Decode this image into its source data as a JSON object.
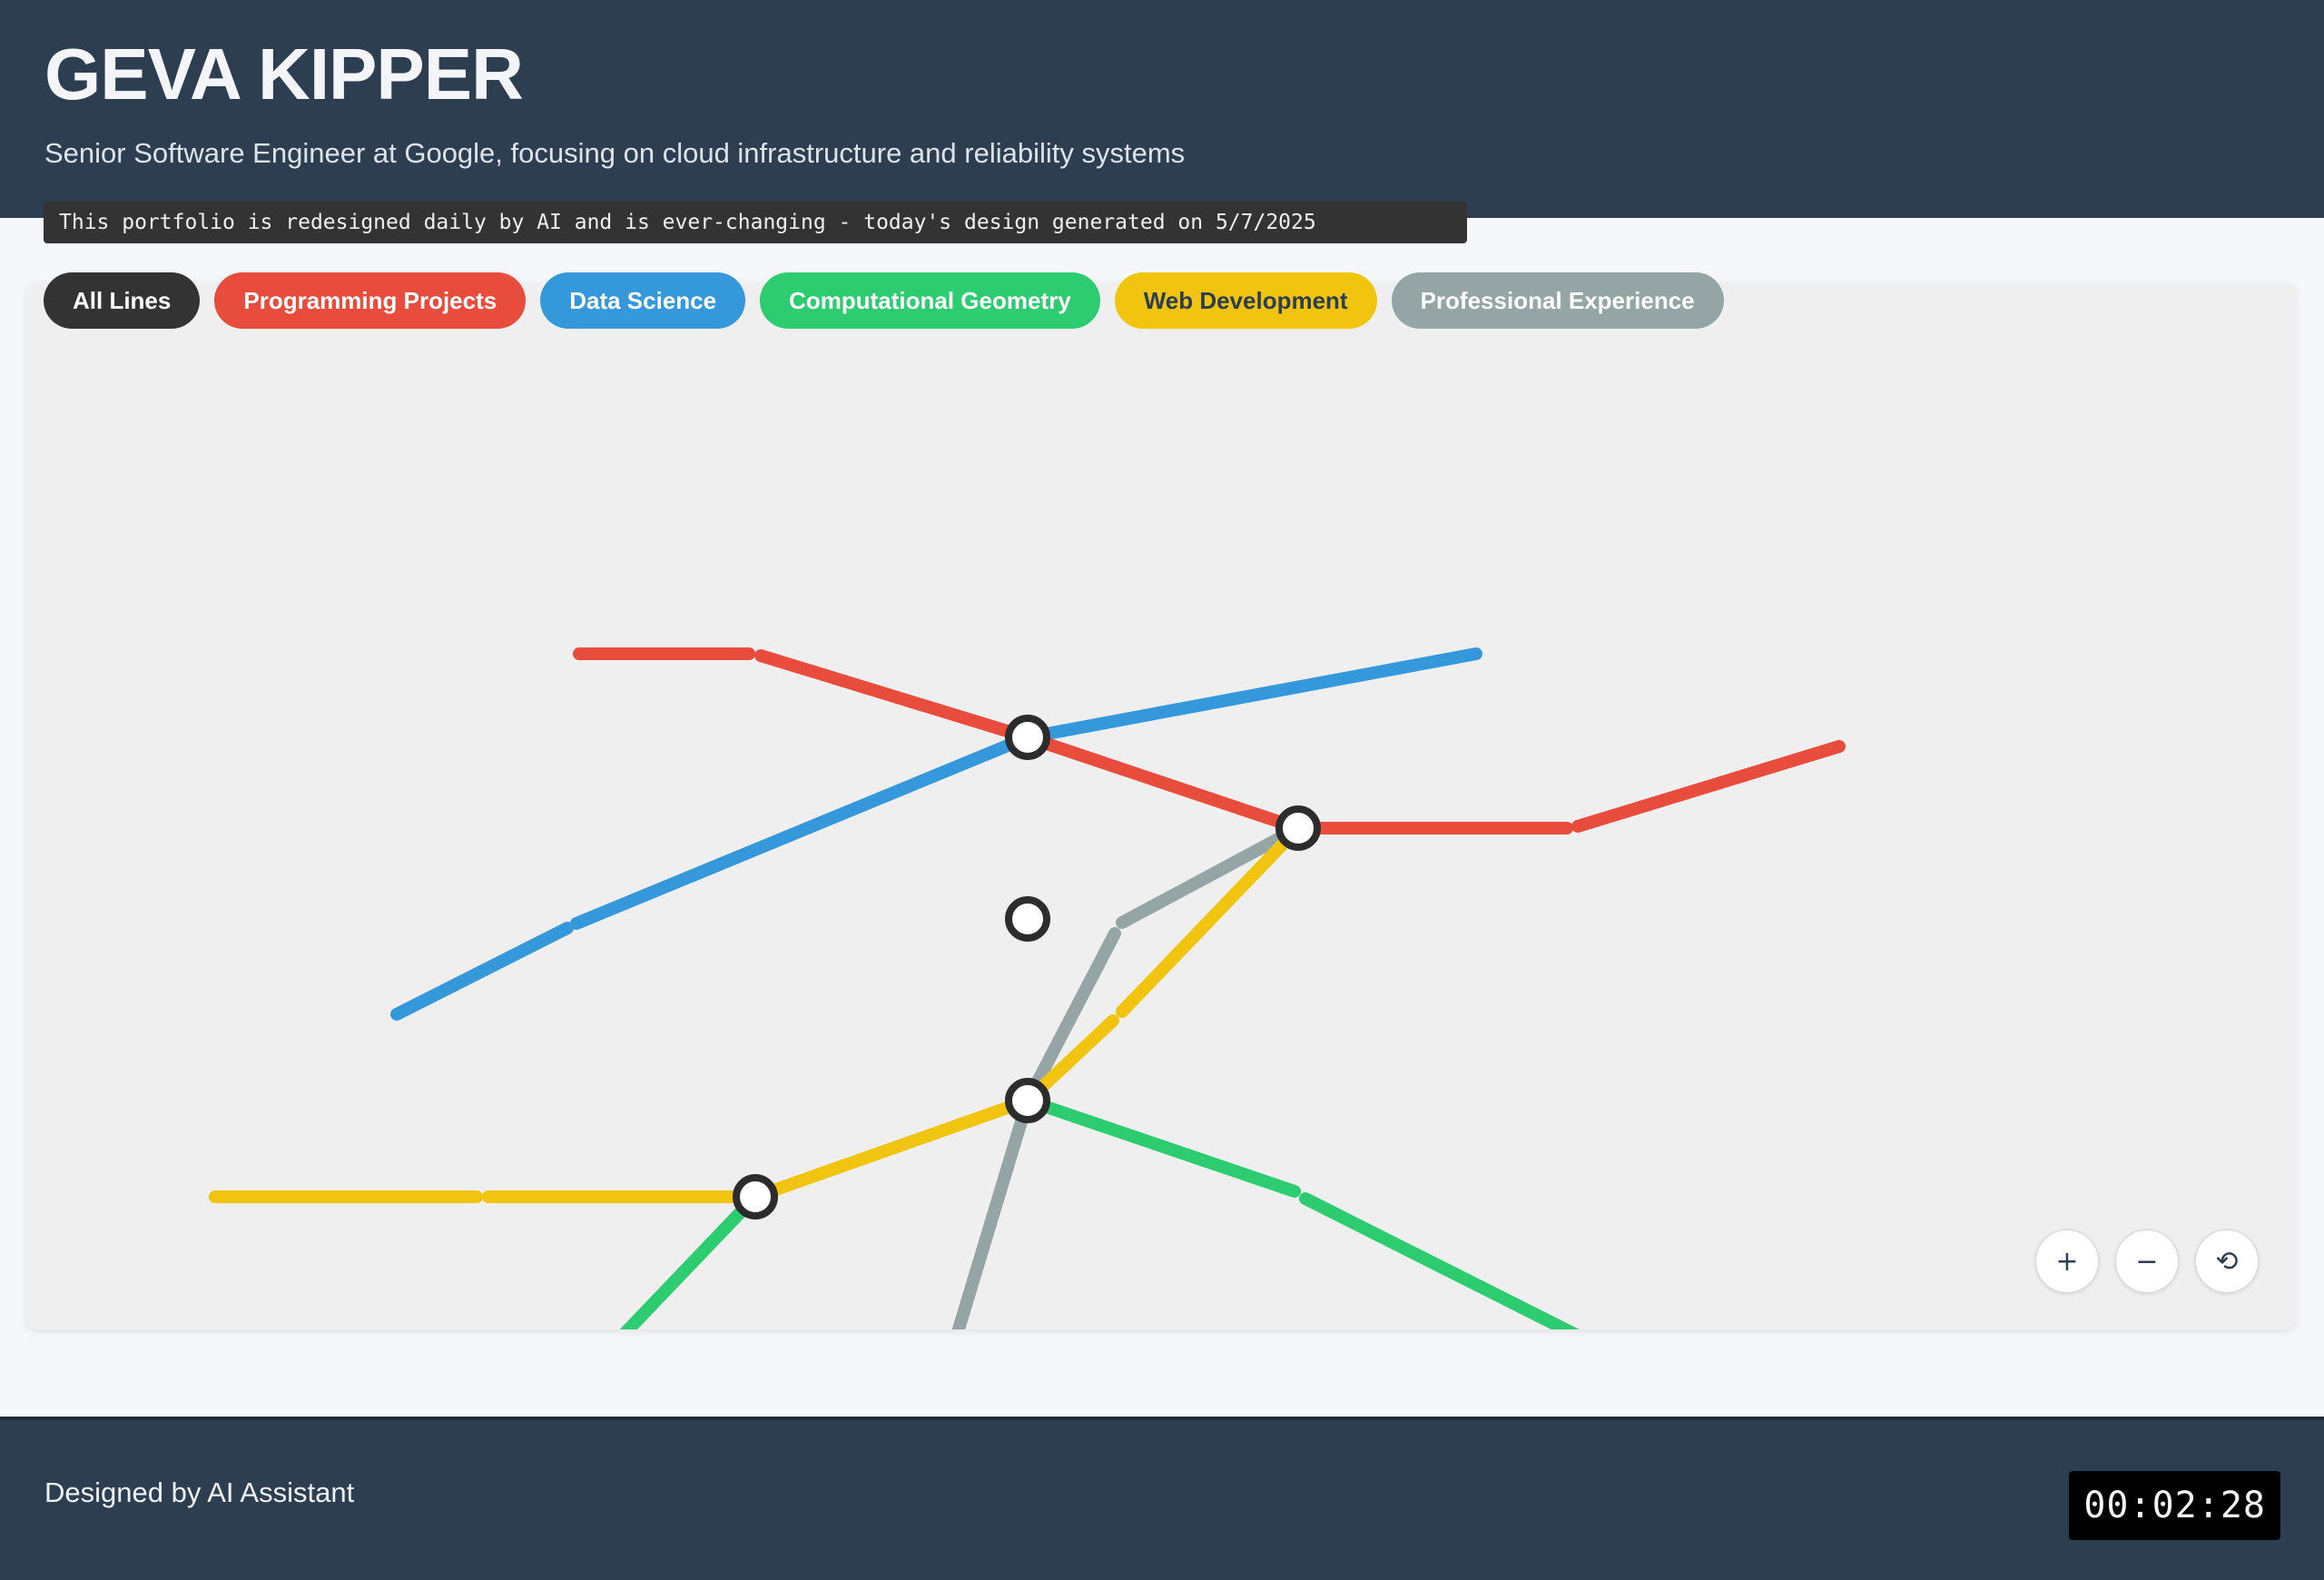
{
  "header": {
    "title": "GEVA KIPPER",
    "subtitle": "Senior Software Engineer at Google, focusing on cloud infrastructure and reliability systems",
    "notice": "This portfolio is redesigned daily by AI and is ever-changing - today's design generated on 5/7/2025"
  },
  "filters": [
    {
      "label": "All Lines",
      "color": "#333333",
      "text_color": "#ffffff"
    },
    {
      "label": "Programming Projects",
      "color": "#e74c3c",
      "text_color": "#ffffff"
    },
    {
      "label": "Data Science",
      "color": "#3498db",
      "text_color": "#ffffff"
    },
    {
      "label": "Computational Geometry",
      "color": "#2ecc71",
      "text_color": "#ffffff"
    },
    {
      "label": "Web Development",
      "color": "#f1c40f",
      "text_color": "#2c3e50"
    },
    {
      "label": "Professional Experience",
      "color": "#95a5a6",
      "text_color": "#ffffff"
    }
  ],
  "map": {
    "line_colors": {
      "programming": "#e74c3c",
      "data_science": "#3498db",
      "geometry": "#2ecc71",
      "web": "#f1c40f",
      "experience": "#95a5a6"
    },
    "station_fill": "#ffffff",
    "station_stroke": "#2c2c2c"
  },
  "zoom": {
    "zoom_in": "+",
    "zoom_out": "−",
    "reset": "⟲"
  },
  "footer": {
    "credit": "Designed by AI Assistant",
    "timer": "00:02:28"
  }
}
